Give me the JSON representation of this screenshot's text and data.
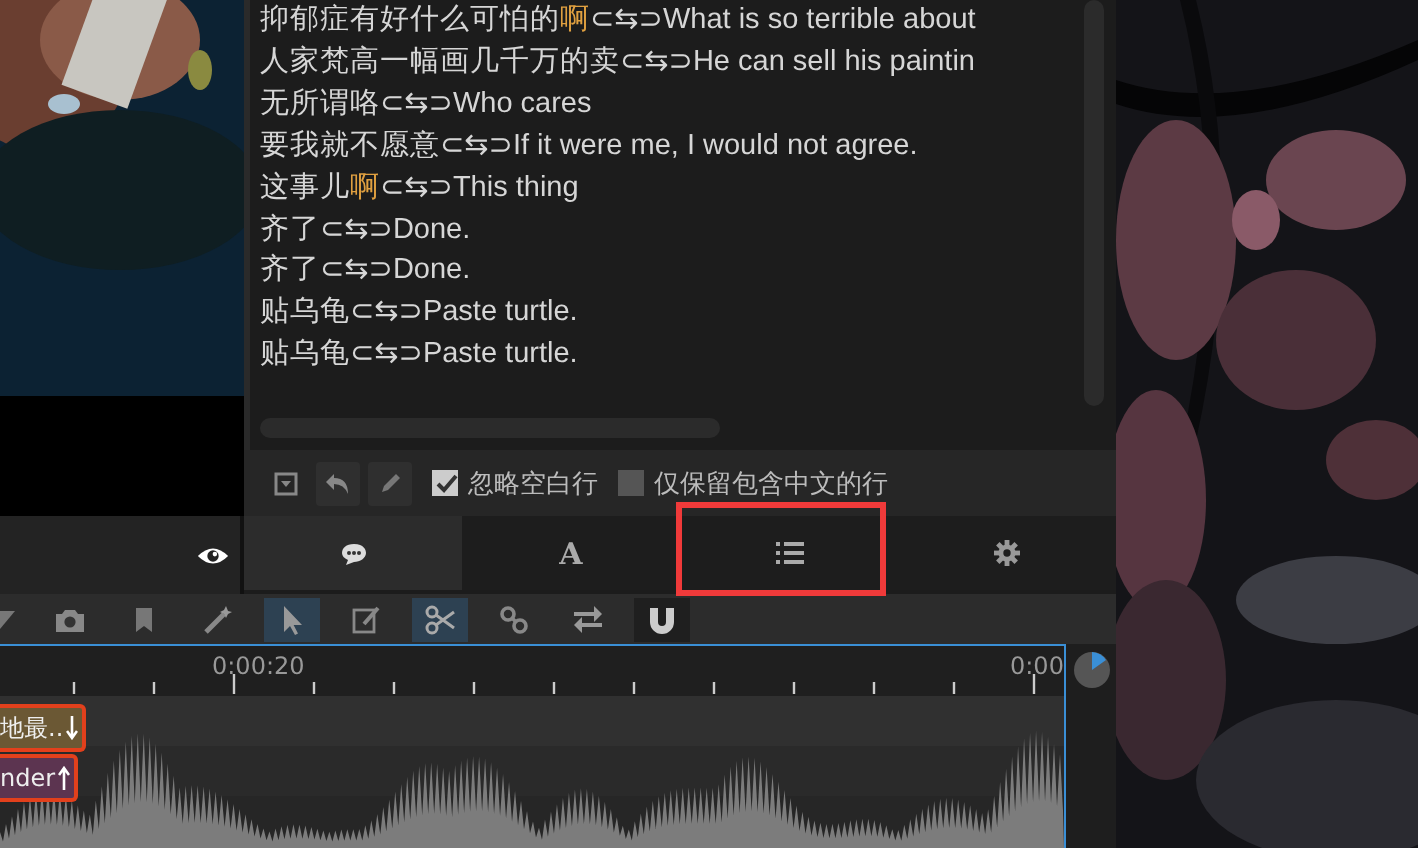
{
  "video": {
    "kind": "picture"
  },
  "lines": [
    {
      "parts": [
        {
          "text": "抑郁症有好什么可怕的",
          "highlight": false
        },
        {
          "text": "啊",
          "highlight": true
        },
        {
          "text": "⊂⇆⊃What is so terrible about",
          "highlight": false
        }
      ]
    },
    {
      "parts": [
        {
          "text": "人家梵高一幅画几千万的卖⊂⇆⊃He can sell his paintin",
          "highlight": false
        }
      ]
    },
    {
      "parts": [
        {
          "text": "无所谓咯⊂⇆⊃Who cares",
          "highlight": false
        }
      ]
    },
    {
      "parts": [
        {
          "text": "要我就不愿意⊂⇆⊃If it were me, I would not agree.",
          "highlight": false
        }
      ]
    },
    {
      "parts": [
        {
          "text": "这事儿",
          "highlight": false
        },
        {
          "text": "啊",
          "highlight": true
        },
        {
          "text": "⊂⇆⊃This thing",
          "highlight": false
        }
      ]
    },
    {
      "parts": [
        {
          "text": "齐了⊂⇆⊃Done.",
          "highlight": false
        }
      ]
    },
    {
      "parts": [
        {
          "text": "齐了⊂⇆⊃Done.",
          "highlight": false
        }
      ]
    },
    {
      "parts": [
        {
          "text": "贴乌龟⊂⇆⊃Paste turtle.",
          "highlight": false
        }
      ]
    },
    {
      "parts": [
        {
          "text": "贴乌龟⊂⇆⊃Paste turtle.",
          "highlight": false
        }
      ]
    }
  ],
  "options": [
    {
      "label": "忽略空白行",
      "checked": true
    },
    {
      "label": "仅保留包含中文的行",
      "checked": false
    }
  ],
  "tabs": [
    {
      "kind": "chat",
      "selected": true
    },
    {
      "kind": "text",
      "label": "A",
      "selected": false
    },
    {
      "kind": "list",
      "selected": false
    },
    {
      "kind": "gear",
      "selected": false
    }
  ],
  "tools": [
    {
      "kind": "shape",
      "selected": false
    },
    {
      "kind": "camera",
      "selected": false
    },
    {
      "kind": "bookmark",
      "selected": false
    },
    {
      "kind": "wand",
      "selected": false
    },
    {
      "kind": "pointer",
      "selected": true
    },
    {
      "kind": "edit",
      "selected": false
    },
    {
      "kind": "scissors",
      "selected": true
    },
    {
      "kind": "link",
      "selected": false
    },
    {
      "kind": "swap",
      "selected": false
    },
    {
      "kind": "magnet",
      "selected": false
    }
  ],
  "ruler": [
    "0:00:20",
    "0:00"
  ],
  "blocks": [
    {
      "text": "地最..",
      "kind": "down",
      "color": "#6b5834"
    },
    {
      "text": "nder",
      "kind": "up",
      "color": "#5c3450"
    }
  ],
  "backdrop": {
    "kind": "picture"
  }
}
